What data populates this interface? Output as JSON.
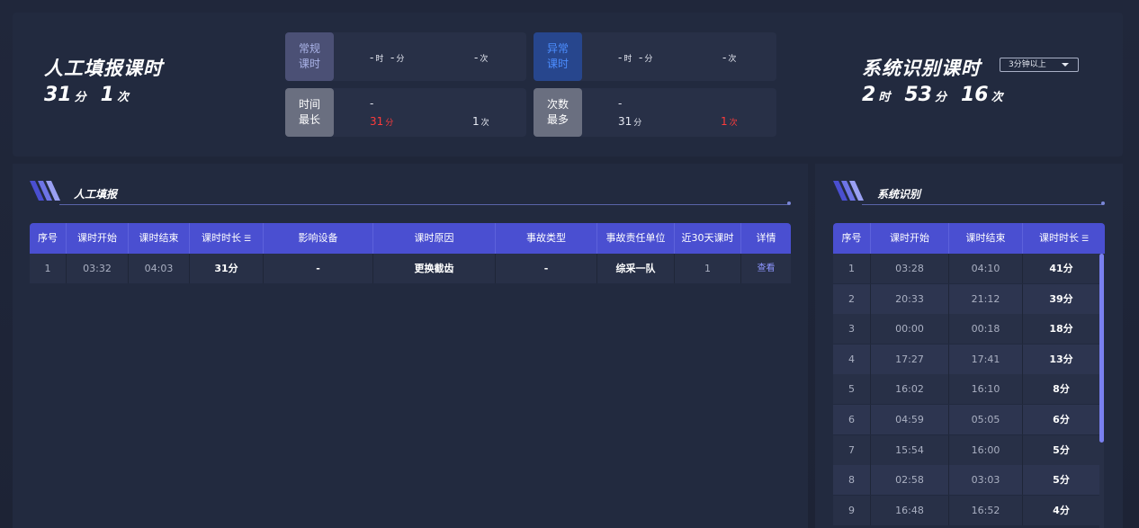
{
  "manual": {
    "title": "人工填报课时",
    "minutes": "31",
    "minutes_unit": "分",
    "count": "1",
    "count_unit": "次"
  },
  "system": {
    "title": "系统识别课时",
    "hours": "2",
    "hours_unit": "时",
    "minutes": "53",
    "minutes_unit": "分",
    "count": "16",
    "count_unit": "次",
    "filter_value": "3分钟以上"
  },
  "cards": {
    "normal": {
      "tag_line1": "常规",
      "tag_line2": "课时",
      "time": "-",
      "time_h_unit": "时",
      "time_m": "-",
      "time_m_unit": "分",
      "count": "-",
      "count_unit": "次"
    },
    "abnormal": {
      "tag_line1": "异常",
      "tag_line2": "课时",
      "time": "-",
      "time_h_unit": "时",
      "time_m": "-",
      "time_m_unit": "分",
      "count": "-",
      "count_unit": "次"
    },
    "longest": {
      "tag_line1": "时间",
      "tag_line2": "最长",
      "name": "-",
      "minutes": "31",
      "minutes_unit": "分",
      "count": "1",
      "count_unit": "次"
    },
    "most": {
      "tag_line1": "次数",
      "tag_line2": "最多",
      "name": "-",
      "minutes": "31",
      "minutes_unit": "分",
      "count": "1",
      "count_unit": "次"
    }
  },
  "manual_section": {
    "title": "人工填报",
    "headers": [
      "序号",
      "课时开始",
      "课时结束",
      "课时时长",
      "影响设备",
      "课时原因",
      "事故类型",
      "事故责任单位",
      "近30天课时",
      "详情"
    ],
    "rows": [
      [
        "1",
        "03:32",
        "04:03",
        "31分",
        "-",
        "更换截齿",
        "-",
        "综采一队",
        "1",
        "查看"
      ]
    ]
  },
  "system_section": {
    "title": "系统识别",
    "headers": [
      "序号",
      "课时开始",
      "课时结束",
      "课时时长"
    ],
    "rows": [
      [
        "1",
        "03:28",
        "04:10",
        "41分"
      ],
      [
        "2",
        "20:33",
        "21:12",
        "39分"
      ],
      [
        "3",
        "00:00",
        "00:18",
        "18分"
      ],
      [
        "4",
        "17:27",
        "17:41",
        "13分"
      ],
      [
        "5",
        "16:02",
        "16:10",
        "8分"
      ],
      [
        "6",
        "04:59",
        "05:05",
        "6分"
      ],
      [
        "7",
        "15:54",
        "16:00",
        "5分"
      ],
      [
        "8",
        "02:58",
        "03:03",
        "5分"
      ],
      [
        "9",
        "16:48",
        "16:52",
        "4分"
      ]
    ]
  },
  "icons": {
    "sort": "sort-icon",
    "dropdown": "chevron-down-icon",
    "section": "stripes-icon"
  },
  "colors": {
    "accent": "#4a4fd1",
    "alert": "#ff3b3b",
    "abnormal": "#4c8dff"
  }
}
